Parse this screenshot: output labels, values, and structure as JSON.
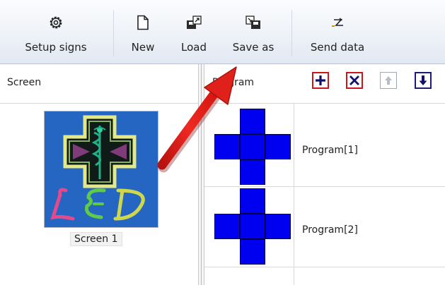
{
  "toolbar": {
    "buttons": [
      {
        "label": "Setup signs",
        "icon": "gear-icon"
      },
      {
        "label": "New",
        "icon": "new-document-icon"
      },
      {
        "label": "Load",
        "icon": "load-icon"
      },
      {
        "label": "Save as",
        "icon": "save-as-icon"
      },
      {
        "label": "Send data",
        "icon": "send-data-icon"
      }
    ]
  },
  "screen_panel": {
    "header": "Screen",
    "screens": [
      {
        "label": "Screen 1",
        "thumbnail_text": "LED"
      }
    ]
  },
  "program_panel": {
    "header": "Program",
    "actions": [
      {
        "icon": "add-icon"
      },
      {
        "icon": "delete-icon"
      },
      {
        "icon": "move-up-icon",
        "enabled": false
      },
      {
        "icon": "move-down-icon"
      }
    ],
    "programs": [
      {
        "label": "Program[1]"
      },
      {
        "label": "Program[2]"
      }
    ]
  },
  "colors": {
    "program_blue": "#0000f0",
    "thumbnail_blue": "#2466c2",
    "annotation_arrow": "#e0211b"
  }
}
